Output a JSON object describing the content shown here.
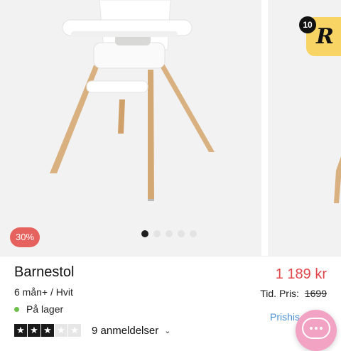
{
  "gallery": {
    "discount_badge": "30%",
    "slide_count": 5,
    "active_slide": 1
  },
  "reward": {
    "count": "10",
    "glyph": "R"
  },
  "product": {
    "title": "Barnestol",
    "variant": "6 mån+ / Hvit",
    "stock": "På lager",
    "stock_color": "#6cc04a",
    "price": "1 189 kr",
    "price_color": "#e0464a",
    "old_price_label": "Tid. Pris:",
    "old_price_value": "1699",
    "history_link": "Prishis",
    "rating": {
      "value": 3,
      "max": 5
    },
    "reviews_label": "9 anmeldelser"
  },
  "icons": {
    "chat": "chat-bubble-icon",
    "chevron": "chevron-down-icon",
    "star": "star-icon"
  }
}
